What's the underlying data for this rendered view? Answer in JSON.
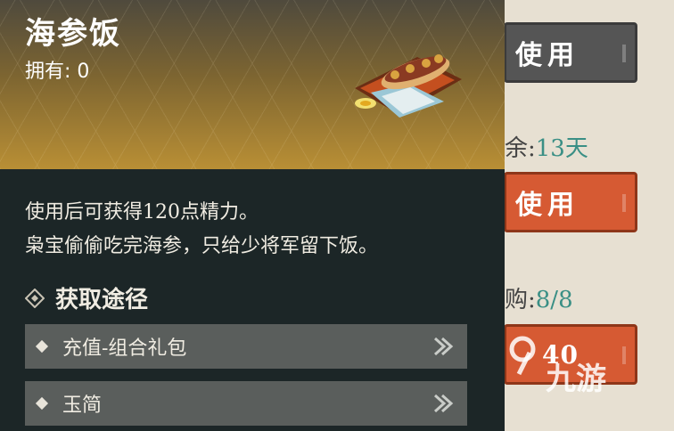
{
  "side": {
    "use_label_1": "使用",
    "use_label_2": "使用",
    "remaining_prefix": "余:",
    "remaining_value": "13天",
    "purchase_prefix": "购:",
    "purchase_value": "8/8",
    "buy_price": "40"
  },
  "tooltip": {
    "title": "海参饭",
    "owned": "拥有: 0",
    "desc_line1": "使用后可获得120点精力。",
    "desc_line2": "枭宝偷偷吃完海参，只给少将军留下饭。",
    "section_title": "获取途径",
    "routes": [
      {
        "label": "充值-组合礼包"
      },
      {
        "label": "玉简"
      }
    ]
  },
  "watermark": {
    "text": "九游"
  },
  "colors": {
    "accent_red": "#d65a33",
    "accent_teal": "#3a8f85"
  },
  "icons": [
    "diamond-icon",
    "arrow-right-icon",
    "food-item-icon",
    "jiuyou-logo-icon"
  ]
}
